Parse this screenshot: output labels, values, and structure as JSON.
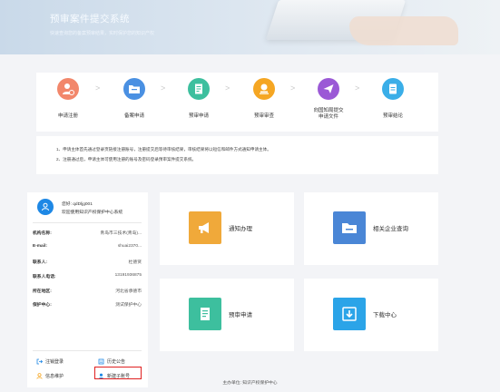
{
  "banner": {
    "title": "预审案件提交系统",
    "subtitle": "快速查询您的备案预审结果，实时保护您的知识产权"
  },
  "steps": [
    {
      "label": "申请注册",
      "icon": "user-register-icon",
      "color": "#f2876b"
    },
    {
      "label": "备案申请",
      "icon": "folder-icon",
      "color": "#4a90e2"
    },
    {
      "label": "预审申请",
      "icon": "document-edit-icon",
      "color": "#3dbf9e"
    },
    {
      "label": "预审审查",
      "icon": "stamp-icon",
      "color": "#f5a623"
    },
    {
      "label": "向国知局提交申请文件",
      "icon": "send-plane-icon",
      "color": "#9b59d6"
    },
    {
      "label": "预审结论",
      "icon": "document-icon",
      "color": "#3aaee8"
    }
  ],
  "notes": [
    "1、申请主体首先通过登录页链接注册账号，注册提交后等待审核结果，审核结果将以短信和邮件方式通知申请主体。",
    "2、注册通过后，申请主体可使用注册的账号及密码登录预审案件提交系统。"
  ],
  "user": {
    "greeting": "您好: qdDljg001",
    "welcome": "欢迎使用知识产权保护中心系统",
    "fields": [
      {
        "key": "机构名称:",
        "value": "青岛市三技术(青岛)..."
      },
      {
        "key": "E-mail:",
        "value": "shuai2370..."
      },
      {
        "key": "联系人:",
        "value": "杜德贤"
      },
      {
        "key": "联系人电话:",
        "value": "13191936875"
      },
      {
        "key": "所在地区:",
        "value": "河北省承德市"
      },
      {
        "key": "保护中心:",
        "value": "测试保护中心"
      }
    ],
    "actions": {
      "logout": "注销登录",
      "history": "历史公告",
      "info": "信息维护",
      "new_account": "新建子账号"
    }
  },
  "tiles": [
    {
      "label": "通知办理",
      "icon": "megaphone-icon",
      "color": "#f0a93a"
    },
    {
      "label": "相关企业查询",
      "icon": "folder-search-icon",
      "color": "#4a86d6"
    },
    {
      "label": "预审申请",
      "icon": "document-edit-icon",
      "color": "#3dbf9e"
    },
    {
      "label": "下载中心",
      "icon": "download-icon",
      "color": "#2ba4e8"
    }
  ],
  "footer": "主办单位: 知识产权保护中心"
}
